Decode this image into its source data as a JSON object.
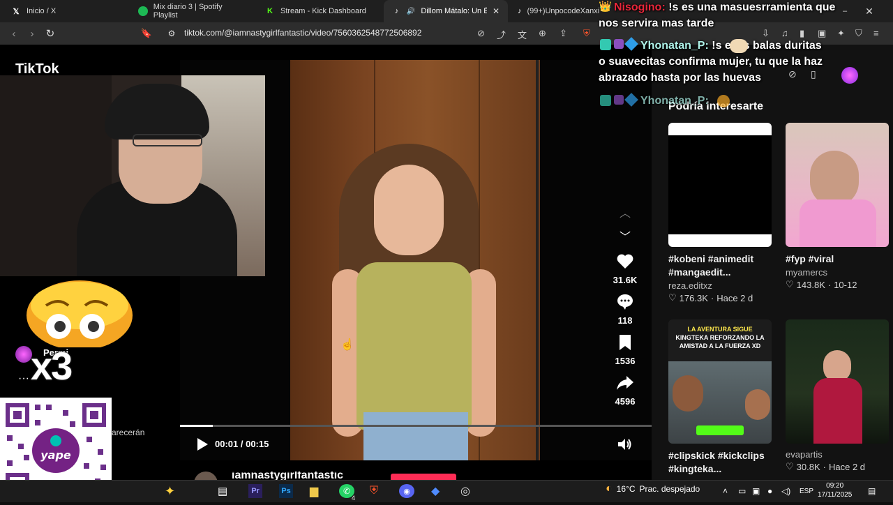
{
  "browser": {
    "tabs": [
      {
        "title": "Inicio / X",
        "icon": "x-icon"
      },
      {
        "title": "Mix diario 3 | Spotify Playlist",
        "icon": "spotify-icon"
      },
      {
        "title": "Stream - Kick Dashboard",
        "icon": "kick-icon"
      },
      {
        "title": "Dillom Mátalo: Un Éx",
        "icon": "tiktok-icon",
        "active": true
      },
      {
        "title": "(99+)UnpocodeXanxi",
        "icon": "tiktok-icon"
      }
    ],
    "url": "tiktok.com/@iamnastygirlfantastic/video/7560362548772506892"
  },
  "tiktok": {
    "logo": "TikTok",
    "section_title": "Podría interesarte",
    "video": {
      "time": "00:01 / 00:15",
      "progress": 0.07,
      "likes": "31.6K",
      "comments": "118",
      "saves": "1536",
      "shares": "4596",
      "author": "iamnastygirlfantastic"
    },
    "cards": [
      {
        "title": "#kobeni #animedit #mangaedit...",
        "author": "reza.editxz",
        "views": "176.3K",
        "date": "Hace 2 d"
      },
      {
        "title": "#fyp #viral",
        "author": "myamercs",
        "views": "143.8K",
        "date": "10-12"
      },
      {
        "title": "#clipskick #kickclips #kingteka...",
        "author": "",
        "views": "",
        "date": "",
        "thumb_text": [
          "LA AVENTURA SIGUE",
          "KINGTEKA REFORZANDO LA",
          "AMISTAD A LA FUERZA XD"
        ]
      },
      {
        "title": "",
        "author": "evapartis",
        "views": "30.8K",
        "date": "Hace 2 d"
      }
    ]
  },
  "stream": {
    "multiplier": "x3",
    "permi_label": "Permi",
    "aparec_label": "arecerán",
    "qr_label": "yape"
  },
  "chat": [
    {
      "user": "Nisogino:",
      "user_color": "#e8263a",
      "text": "!s es una masuesrramienta que"
    },
    {
      "user": "",
      "text": "nos servira mas tarde"
    },
    {
      "user": "Yhonatan_P:",
      "user_color": "#aef2e8",
      "text": "!s      esas balas duritas"
    },
    {
      "user": "",
      "text": "o suavecitas confirma mujer, tu que la haz"
    },
    {
      "user": "",
      "text": "abrazado hasta por las huevas"
    },
    {
      "user": "Yhonatan_P:",
      "user_color": "#aef2e8",
      "text": ""
    }
  ],
  "taskbar": {
    "weather_temp": "16°C",
    "weather_desc": "Prac. despejado",
    "lang": "ESP",
    "time": "09:20",
    "date": "17/11/2025",
    "whatsapp_badge": "4"
  }
}
